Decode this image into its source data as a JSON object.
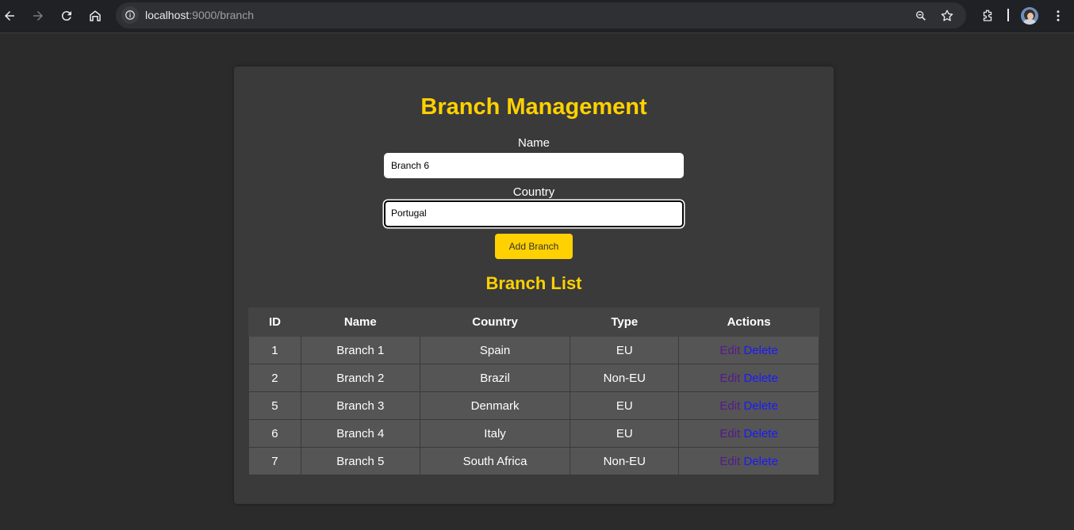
{
  "browser": {
    "url_host": "localhost",
    "url_path": ":9000/branch"
  },
  "page": {
    "title": "Branch Management",
    "form": {
      "name_label": "Name",
      "name_value": "Branch 6",
      "country_label": "Country",
      "country_value": "Portugal",
      "submit_label": "Add Branch"
    },
    "list_title": "Branch List",
    "table": {
      "headers": [
        "ID",
        "Name",
        "Country",
        "Type",
        "Actions"
      ],
      "rows": [
        {
          "id": "1",
          "name": "Branch 1",
          "country": "Spain",
          "type": "EU"
        },
        {
          "id": "2",
          "name": "Branch 2",
          "country": "Brazil",
          "type": "Non-EU"
        },
        {
          "id": "5",
          "name": "Branch 3",
          "country": "Denmark",
          "type": "EU"
        },
        {
          "id": "6",
          "name": "Branch 4",
          "country": "Italy",
          "type": "EU"
        },
        {
          "id": "7",
          "name": "Branch 5",
          "country": "South Africa",
          "type": "Non-EU"
        }
      ],
      "edit_label": "Edit",
      "delete_label": "Delete"
    }
  },
  "colors": {
    "accent": "#ffd100",
    "background": "#2b2b2b",
    "card": "#3a3a3a"
  }
}
